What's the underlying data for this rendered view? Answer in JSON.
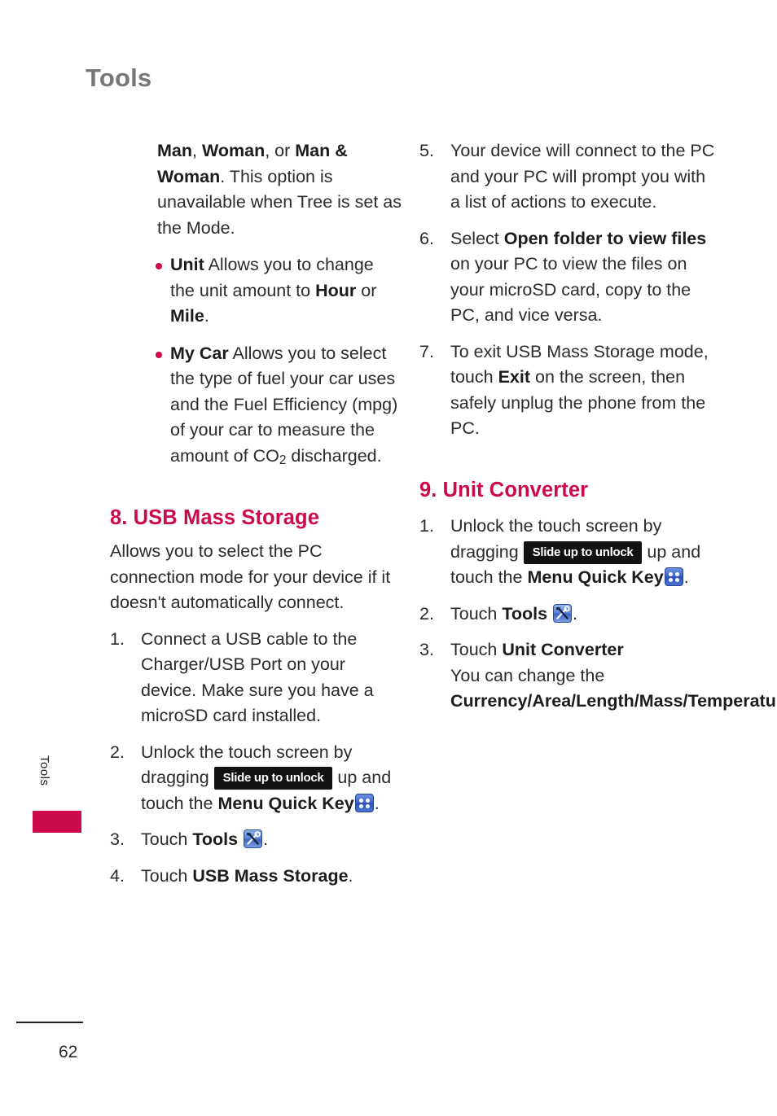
{
  "page": {
    "title": "Tools",
    "side_tab_label": "Tools",
    "page_number": "62",
    "accent_color": "#CC0A4A",
    "heading_color": "#CC0A4A",
    "title_color": "#777777",
    "body_color": "#2b2b2b"
  },
  "icons": {
    "menu_quick_key": "menu-quick-key-icon",
    "tools": "tools-icon",
    "unlock_chip_label": "Slide up to unlock"
  },
  "left_column": {
    "continued_paragraph": {
      "b1": "Man",
      "t1": ", ",
      "b2": "Woman",
      "t2": ", or ",
      "b3": "Man & Woman",
      "t3": ". This option is unavailable when Tree is set as the Mode."
    },
    "bullets": [
      {
        "term": "Unit",
        "text_a": " Allows you to change the unit amount to ",
        "term_b": "Hour",
        "text_b": " or ",
        "term_c": "Mile",
        "text_c": "."
      },
      {
        "term": "My Car",
        "text_a": " Allows you to select the type of fuel your car uses and the Fuel Efficiency (mpg) of your car to measure the amount of CO",
        "sub": "2",
        "text_b": " discharged."
      }
    ],
    "section": {
      "heading": "8. USB Mass Storage",
      "intro": "Allows you to select the PC connection mode for your device if it doesn't automatically connect.",
      "steps": [
        {
          "num": "1.",
          "text": "Connect a USB cable to the Charger/USB Port on your device. Make sure you have a microSD card installed."
        },
        {
          "num": "2.",
          "pre": "Unlock the touch screen by dragging ",
          "chip": "Slide up to unlock",
          "mid": " up and touch the ",
          "bold": "Menu Quick Key",
          "post": "."
        },
        {
          "num": "3.",
          "pre": "Touch ",
          "bold": "Tools",
          "post": "."
        },
        {
          "num": "4.",
          "pre": "Touch ",
          "bold": "USB Mass Storage",
          "post": "."
        }
      ]
    }
  },
  "right_column": {
    "steps_continued": [
      {
        "num": "5.",
        "text": "Your device will connect to the PC and your PC will prompt you with a list of actions to execute."
      },
      {
        "num": "6.",
        "pre": "Select ",
        "bold": "Open folder to view files",
        "post": " on your PC to view the files on your microSD card, copy to the PC, and vice versa."
      },
      {
        "num": "7.",
        "pre": "To exit USB Mass Storage mode, touch ",
        "bold": "Exit",
        "post": " on the screen, then safely unplug the phone from the PC."
      }
    ],
    "section": {
      "heading": "9. Unit Converter",
      "steps": [
        {
          "num": "1.",
          "pre": "Unlock the touch screen by dragging ",
          "chip": "Slide up to unlock",
          "mid": " up and touch the ",
          "bold": "Menu Quick Key",
          "post": "."
        },
        {
          "num": "2.",
          "pre": "Touch ",
          "bold": "Tools",
          "post": "."
        },
        {
          "num": "3.",
          "pre": "Touch ",
          "bold": "Unit Converter",
          "line2": "You can change the ",
          "bold2": "Currency/Area/Length/Mass/Temperature/Volume/Velocity",
          "post": "."
        }
      ]
    }
  }
}
